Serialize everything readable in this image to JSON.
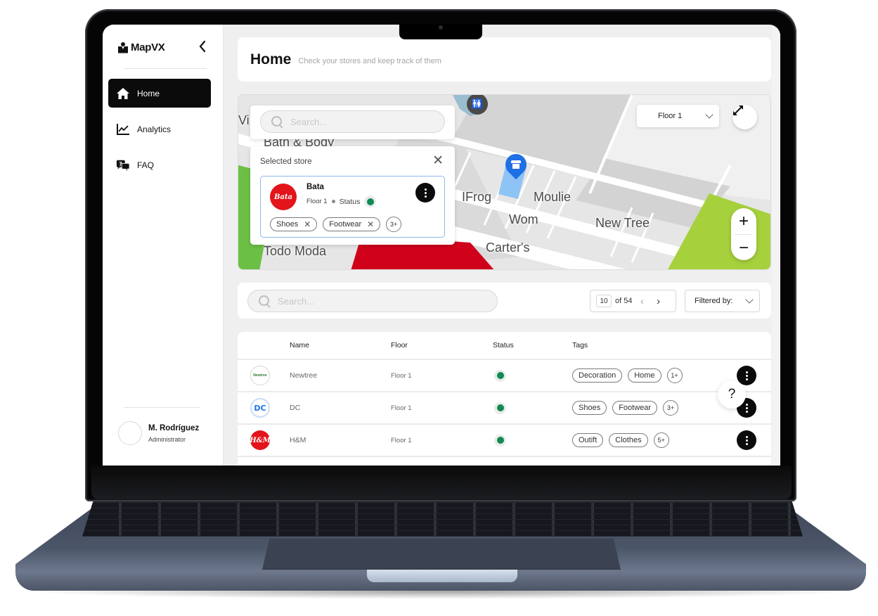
{
  "app": {
    "name": "MapVX",
    "collapse_icon": "chevron-left-icon"
  },
  "sidebar": {
    "items": [
      {
        "label": "Home",
        "icon": "home-icon",
        "active": true
      },
      {
        "label": "Analytics",
        "icon": "chart-line-icon",
        "active": false
      },
      {
        "label": "FAQ",
        "icon": "chat-question-icon",
        "active": false
      }
    ],
    "user": {
      "name": "M. Rodríguez",
      "role": "Administrator"
    }
  },
  "header": {
    "title": "Home",
    "subtitle": "Check your stores and keep track of them"
  },
  "map": {
    "search_placeholder": "Search...",
    "floor_select": "Floor 1",
    "zoom_in": "+",
    "zoom_out": "−",
    "labels": [
      "Bath & Body",
      "IFrog",
      "Moulie",
      "Wom",
      "New Tree",
      "Carter's",
      "Todo Moda",
      "Vi"
    ],
    "selected_store": {
      "title": "Selected store",
      "name": "Bata",
      "logo_text": "Bata",
      "floor": "Floor 1",
      "status_label": "Status",
      "status": "active",
      "tags": [
        "Shoes",
        "Footwear"
      ],
      "more_tags": "3+"
    }
  },
  "toolbar": {
    "search_placeholder": "Search...",
    "page_current": "10",
    "page_total_text": "of 54",
    "filter_label": "Filtered by:"
  },
  "table": {
    "columns": [
      "Name",
      "Floor",
      "Status",
      "Tags"
    ],
    "rows": [
      {
        "logo": "Newtree",
        "name": "Newtree",
        "floor": "Floor 1",
        "status": "active",
        "tags": [
          "Decoration",
          "Home"
        ],
        "more": "1+"
      },
      {
        "logo": "DC",
        "name": "DC",
        "floor": "Floor 1",
        "status": "active",
        "tags": [
          "Shoes",
          "Footwear"
        ],
        "more": "3+"
      },
      {
        "logo": "H&M",
        "name": "H&M",
        "floor": "Floor 1",
        "status": "active",
        "tags": [
          "Outift",
          "Clothes"
        ],
        "more": "5+"
      }
    ]
  },
  "help": {
    "label": "?"
  },
  "colors": {
    "active_nav": "#0b0b0b",
    "status_active": "#0f8a55",
    "pin": "#1f6fe5",
    "selected_border": "#8fb6ea",
    "map_green": "#a6d13c",
    "map_red": "#d0021b"
  }
}
